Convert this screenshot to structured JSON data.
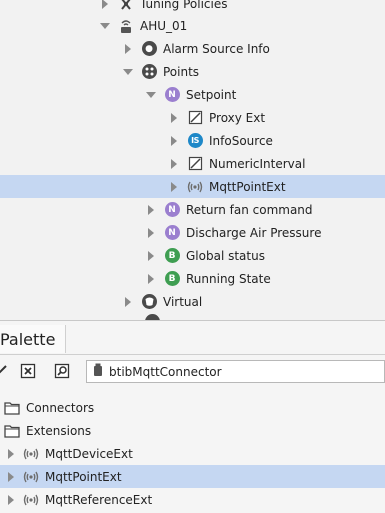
{
  "nav_tree": {
    "items": [
      {
        "label": "Tuning Policies",
        "icon": "tuning-icon",
        "expander": "right"
      },
      {
        "label": "AHU_01",
        "icon": "device-icon",
        "expander": "down"
      },
      {
        "label": "Alarm Source Info",
        "icon": "alarm-icon",
        "expander": "right"
      },
      {
        "label": "Points",
        "icon": "points-icon",
        "expander": "down"
      },
      {
        "label": "Setpoint",
        "icon": "numeric-point-icon",
        "badge": "N",
        "expander": "down"
      },
      {
        "label": "Proxy Ext",
        "icon": "proxy-ext-icon",
        "expander": "right"
      },
      {
        "label": "InfoSource",
        "icon": "info-source-icon",
        "badge": "IS",
        "expander": "right"
      },
      {
        "label": "NumericInterval",
        "icon": "interval-icon",
        "expander": "right"
      },
      {
        "label": "MqttPointExt",
        "icon": "mqtt-icon",
        "expander": "right",
        "selected": true
      },
      {
        "label": "Return fan command",
        "icon": "numeric-point-icon",
        "badge": "N",
        "expander": "right"
      },
      {
        "label": "Discharge Air Pressure",
        "icon": "numeric-point-icon",
        "badge": "N",
        "expander": "right"
      },
      {
        "label": "Global status",
        "icon": "boolean-point-icon",
        "badge": "B",
        "expander": "right"
      },
      {
        "label": "Running State",
        "icon": "boolean-point-icon",
        "badge": "B",
        "expander": "right"
      },
      {
        "label": "Virtual",
        "icon": "virtual-icon",
        "expander": "right"
      }
    ]
  },
  "palette": {
    "title": "Palette",
    "module": "btibMqttConnector",
    "items": [
      {
        "label": "Connectors",
        "icon": "folder-icon"
      },
      {
        "label": "Extensions",
        "icon": "folder-icon"
      },
      {
        "label": "MqttDeviceExt",
        "icon": "mqtt-icon",
        "expander": "right"
      },
      {
        "label": "MqttPointExt",
        "icon": "mqtt-icon",
        "expander": "right",
        "selected": true
      },
      {
        "label": "MqttReferenceExt",
        "icon": "mqtt-icon",
        "expander": "right"
      }
    ]
  },
  "colors": {
    "selection": "#c5d7f2",
    "numeric_badge": "#9b7fcf",
    "boolean_badge": "#3f9e52",
    "info_badge": "#1e88c8"
  }
}
